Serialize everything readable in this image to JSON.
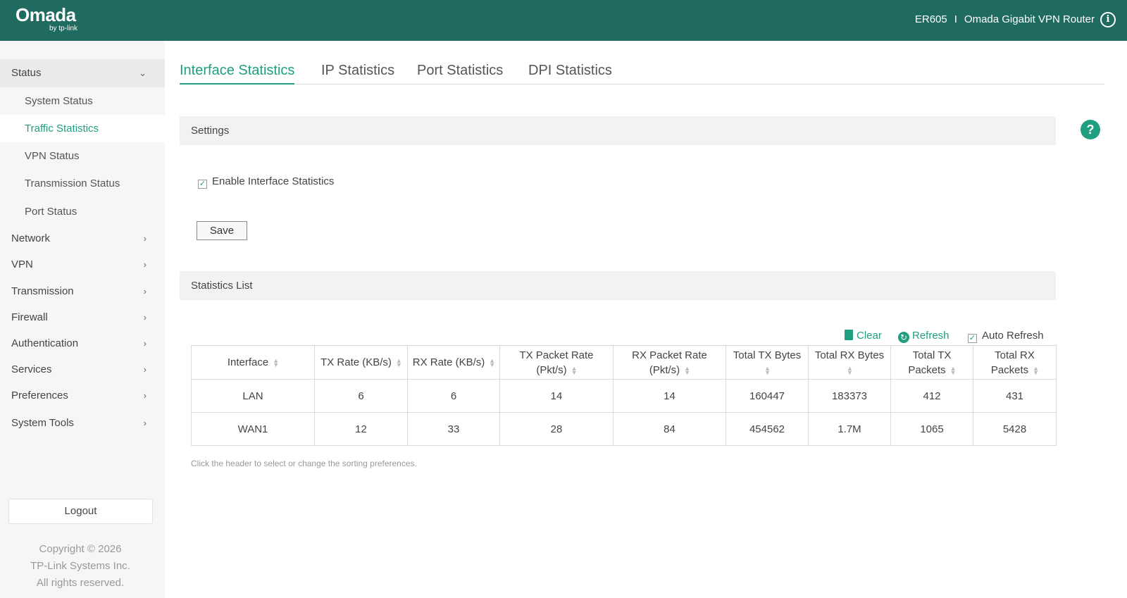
{
  "header": {
    "logo_main": "Omada",
    "logo_sub": "by tp-link",
    "model": "ER605",
    "separator": "I",
    "product": "Omada Gigabit VPN Router",
    "info_glyph": "i"
  },
  "sidebar": {
    "groups": [
      {
        "label": "Status",
        "chevron": "⌄"
      },
      {
        "label": "Network",
        "chevron": "›"
      },
      {
        "label": "VPN",
        "chevron": "›"
      },
      {
        "label": "Transmission",
        "chevron": "›"
      },
      {
        "label": "Firewall",
        "chevron": "›"
      },
      {
        "label": "Authentication",
        "chevron": "›"
      },
      {
        "label": "Services",
        "chevron": "›"
      },
      {
        "label": "Preferences",
        "chevron": "›"
      },
      {
        "label": "System Tools",
        "chevron": "›"
      }
    ],
    "status_items": [
      "System Status",
      "Traffic Statistics",
      "VPN Status",
      "Transmission Status",
      "Port Status"
    ],
    "logout": "Logout",
    "copyright": [
      "Copyright © 2026",
      "TP-Link Systems Inc.",
      "All rights reserved."
    ]
  },
  "tabs": [
    "Interface Statistics",
    "IP Statistics",
    "Port Statistics",
    "DPI Statistics"
  ],
  "help_glyph": "?",
  "settings": {
    "title": "Settings",
    "enable_label": "Enable Interface Statistics",
    "check_glyph": "✓",
    "save_label": "Save"
  },
  "statistics": {
    "title": "Statistics List",
    "clear_label": "Clear",
    "refresh_label": "Refresh",
    "refresh_glyph": "↻",
    "auto_refresh_label": "Auto Refresh",
    "sort_glyph_up": "▲",
    "sort_glyph_down": "▼",
    "columns": [
      [
        "Interface"
      ],
      [
        "TX Rate (KB/s)"
      ],
      [
        "RX Rate (KB/s)"
      ],
      [
        "TX Packet Rate",
        "(Pkt/s)"
      ],
      [
        "RX Packet Rate",
        "(Pkt/s)"
      ],
      [
        "Total TX Bytes"
      ],
      [
        "Total RX Bytes"
      ],
      [
        "Total TX",
        "Packets"
      ],
      [
        "Total RX",
        "Packets"
      ]
    ],
    "rows": [
      [
        "LAN",
        "6",
        "6",
        "14",
        "14",
        "160447",
        "183373",
        "412",
        "431"
      ],
      [
        "WAN1",
        "12",
        "33",
        "28",
        "84",
        "454562",
        "1.7M",
        "1065",
        "5428"
      ]
    ],
    "hint": "Click the header to select or change the sorting preferences."
  },
  "colors": {
    "header_bg": "#1f6b5f",
    "accent": "#1f9e80"
  }
}
